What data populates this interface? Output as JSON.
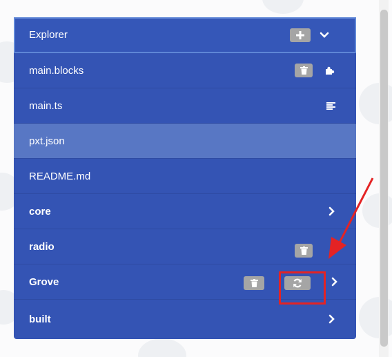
{
  "explorer": {
    "header": {
      "label": "Explorer",
      "add_icon": "plus-icon",
      "collapse_icon": "chevron-down-icon"
    },
    "files": [
      {
        "label": "main.blocks",
        "actions": [
          "trash-icon"
        ],
        "type_icon": "puzzle-icon"
      },
      {
        "label": "main.ts",
        "type_icon": "align-left-icon"
      },
      {
        "label": "pxt.json",
        "selected": true
      },
      {
        "label": "README.md"
      }
    ],
    "packages": [
      {
        "label": "core",
        "expand_icon": "chevron-right-icon"
      },
      {
        "label": "radio",
        "actions": [
          "trash-icon"
        ]
      },
      {
        "label": "Grove",
        "actions": [
          "trash-icon",
          "refresh-icon"
        ],
        "expand_icon": "chevron-right-icon",
        "highlighted_action": "refresh-icon"
      },
      {
        "label": "built",
        "expand_icon": "chevron-right-icon"
      }
    ]
  },
  "colors": {
    "panel_background": "#3454b4",
    "selected_row": "#5877c4",
    "action_button": "#a5a5a5",
    "annotation": "#e42324"
  }
}
